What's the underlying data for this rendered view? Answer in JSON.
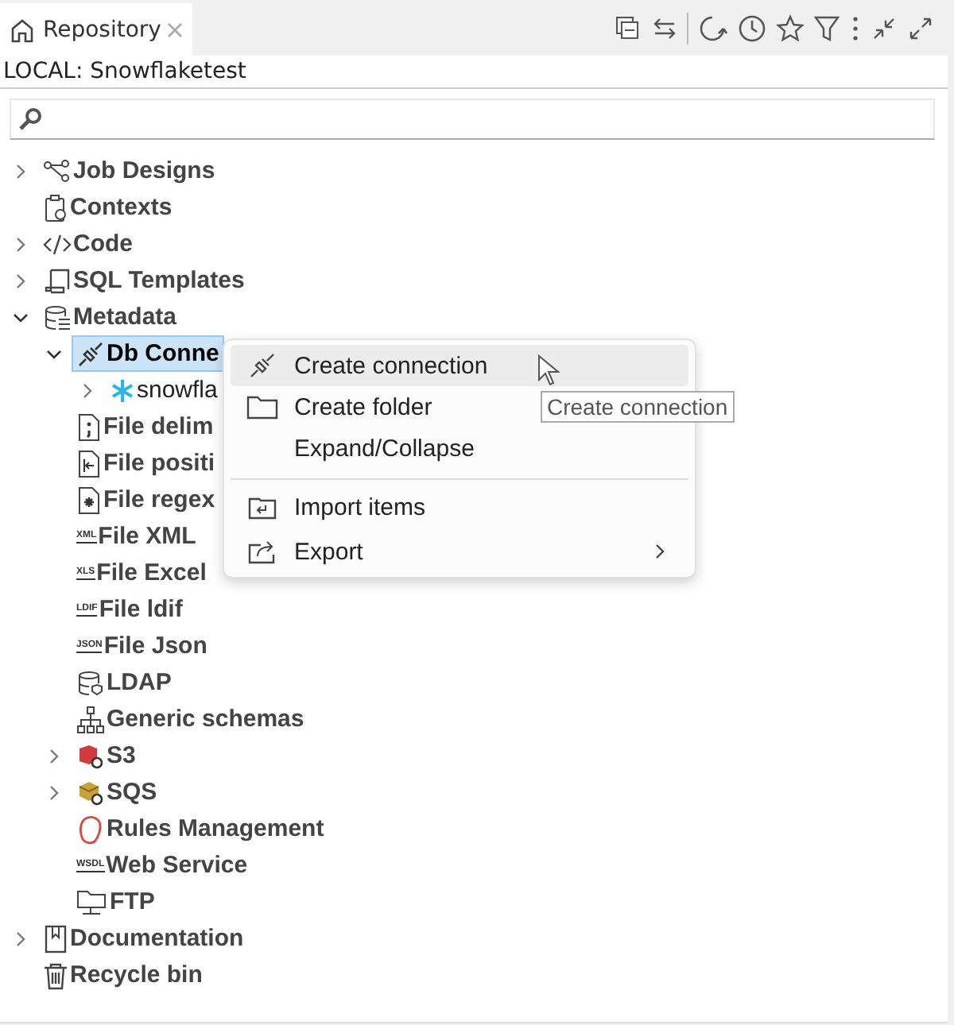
{
  "tab": {
    "title": "Repository",
    "selected": true
  },
  "header": "LOCAL: Snowflaketest",
  "tree": [
    {
      "label": "Job Designs",
      "kind": "nodes",
      "expanded": false,
      "selected": false
    },
    {
      "label": "Contexts",
      "kind": "clipboard",
      "selected": false
    },
    {
      "label": "Code",
      "kind": "code",
      "expanded": false,
      "selected": false
    },
    {
      "label": "SQL Templates",
      "kind": "scroll",
      "expanded": false,
      "selected": false
    },
    {
      "label": "Metadata",
      "kind": "database",
      "expanded": true,
      "selected": false,
      "children": [
        {
          "label": "Db Conne",
          "kind": "plug",
          "expanded": true,
          "selected": true,
          "children": [
            {
              "label": "snowfla",
              "kind": "snowflake",
              "expanded": false,
              "selected": false,
              "bold": false
            }
          ]
        },
        {
          "label": "File delim",
          "kind": "file-semicolon",
          "selected": false
        },
        {
          "label": "File positi",
          "kind": "file-arrow",
          "selected": false
        },
        {
          "label": "File regex",
          "kind": "file-star",
          "selected": false
        },
        {
          "label": "File XML",
          "kind": "badge",
          "badge": "XML",
          "selected": false
        },
        {
          "label": "File Excel",
          "kind": "badge",
          "badge": "XLS",
          "selected": false
        },
        {
          "label": "File ldif",
          "kind": "badge",
          "badge": "LDIF",
          "selected": false
        },
        {
          "label": "File Json",
          "kind": "badge",
          "badge": "JSON",
          "selected": false
        },
        {
          "label": "LDAP",
          "kind": "database-shield",
          "selected": false
        },
        {
          "label": "Generic schemas",
          "kind": "hierarchy",
          "selected": false
        },
        {
          "label": "S3",
          "kind": "red-cube",
          "expanded": false,
          "selected": false
        },
        {
          "label": "SQS",
          "kind": "gold-box",
          "expanded": false,
          "selected": false
        },
        {
          "label": "Rules Management",
          "kind": "head",
          "selected": false
        },
        {
          "label": "Web Service",
          "kind": "badge",
          "badge": "WSDL",
          "selected": false
        },
        {
          "label": "FTP",
          "kind": "folder-network",
          "selected": false
        }
      ]
    },
    {
      "label": "Documentation",
      "kind": "book",
      "expanded": false,
      "selected": false
    },
    {
      "label": "Recycle bin",
      "kind": "trash",
      "selected": false
    }
  ],
  "context_menu": [
    {
      "label": "Create connection",
      "kind": "plug",
      "selected": true,
      "submenu": false,
      "separator_before": false
    },
    {
      "label": "Create folder",
      "kind": "folder",
      "selected": false,
      "separator_before": false
    },
    {
      "label": "Expand/Collapse",
      "kind": "plain",
      "selected": false,
      "submenu": false,
      "separator_before": false
    },
    {
      "label": "Import items",
      "kind": "import",
      "selected": false,
      "submenu": false,
      "separator_before": true
    },
    {
      "label": "Export",
      "kind": "export",
      "selected": false,
      "submenu": true,
      "separator_before": false
    }
  ],
  "tooltip": "Create connection"
}
